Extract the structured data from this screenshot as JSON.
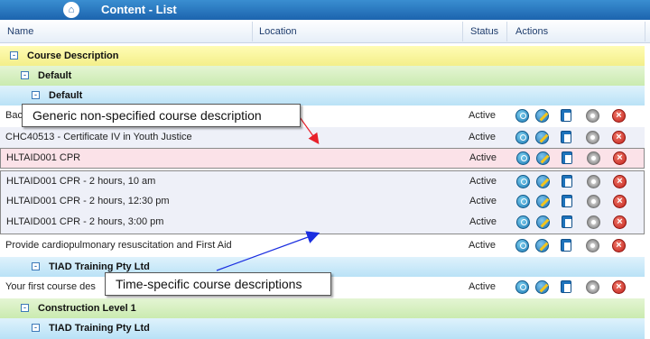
{
  "window": {
    "title": "Content - List",
    "home_icon": "home-icon"
  },
  "columns": {
    "name": "Name",
    "location": "Location",
    "status": "Status",
    "actions": "Actions"
  },
  "groups": [
    {
      "label": "Course Description",
      "toggle": "⊟"
    },
    {
      "label": "Default",
      "toggle": "⊟"
    },
    {
      "label": "Default",
      "toggle": "⊟"
    },
    {
      "label": "TIAD Training Pty Ltd",
      "toggle": "⊟"
    },
    {
      "label": "Construction Level 1",
      "toggle": "⊟"
    },
    {
      "label": "TIAD Training Pty Ltd",
      "toggle": "⊟"
    }
  ],
  "rows": [
    {
      "name": "Bac",
      "status": "Active"
    },
    {
      "name": "CHC40513 - Certificate IV in Youth Justice",
      "status": "Active"
    },
    {
      "name": "HLTAID001 CPR",
      "status": "Active"
    },
    {
      "name": "HLTAID001 CPR - 2 hours, 10 am",
      "status": "Active"
    },
    {
      "name": "HLTAID001 CPR - 2 hours, 12:30 pm",
      "status": "Active"
    },
    {
      "name": "HLTAID001 CPR - 2 hours, 3:00 pm",
      "status": "Active"
    },
    {
      "name": "Provide cardiopulmonary resuscitation and First Aid",
      "status": "Active"
    },
    {
      "name": "Your first course des",
      "status": "Active"
    }
  ],
  "action_icons": [
    "view-icon",
    "edit-icon",
    "copy-icon",
    "settings-icon",
    "delete-icon"
  ],
  "callouts": {
    "generic": "Generic non-specified course description",
    "time_specific": "Time-specific course descriptions"
  },
  "colors": {
    "arrow_red": "#e8202a",
    "arrow_blue": "#1a2ee0",
    "title_bar": "#1c64ae"
  }
}
